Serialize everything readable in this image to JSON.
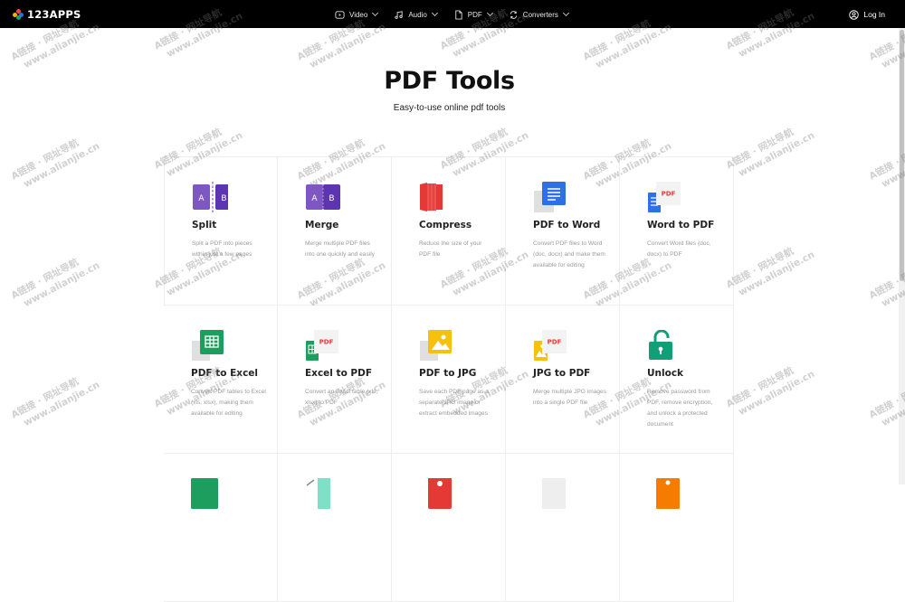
{
  "app": {
    "logo_text": "123APPS",
    "logo_colors": [
      "#f8b000",
      "#e84a3c",
      "#2d6ee8",
      "#19a463"
    ]
  },
  "nav": {
    "items": [
      {
        "label": "Video",
        "icon": "video-icon"
      },
      {
        "label": "Audio",
        "icon": "audio-icon"
      },
      {
        "label": "PDF",
        "icon": "pdf-doc-icon"
      },
      {
        "label": "Converters",
        "icon": "converters-icon"
      }
    ],
    "login_label": "Log In"
  },
  "page": {
    "title": "PDF Tools",
    "subtitle": "Easy-to-use online pdf tools"
  },
  "tools": [
    {
      "name": "Split",
      "desc": "Split a PDF into pieces within just a few pages",
      "icon": "split-icon"
    },
    {
      "name": "Merge",
      "desc": "Merge multiple PDF files into one quickly and easily",
      "icon": "merge-icon"
    },
    {
      "name": "Compress",
      "desc": "Reduce the size of your PDF file",
      "icon": "compress-icon"
    },
    {
      "name": "PDF to Word",
      "desc": "Convert PDF files to Word (doc, docx) and make them available for editing",
      "icon": "pdf-to-word-icon"
    },
    {
      "name": "Word to PDF",
      "desc": "Convert Word files (doc, docx) to PDF",
      "icon": "word-to-pdf-icon"
    },
    {
      "name": "PDF to Excel",
      "desc": "Convert PDF tables to Excel (xls, xlsx), making them available for editing",
      "icon": "pdf-to-excel-icon"
    },
    {
      "name": "Excel to PDF",
      "desc": "Convert an Excel table (xls, xlsx) to PDF",
      "icon": "excel-to-pdf-icon"
    },
    {
      "name": "PDF to JPG",
      "desc": "Save each PDF page as a separate JPG image or extract embedded images",
      "icon": "pdf-to-jpg-icon"
    },
    {
      "name": "JPG to PDF",
      "desc": "Merge multiple JPG images into a single PDF file",
      "icon": "jpg-to-pdf-icon"
    },
    {
      "name": "Unlock",
      "desc": "Remove password from PDF, remove encryption, and unlock a protected document",
      "icon": "unlock-icon"
    }
  ],
  "icon_labels": {
    "split_a": "A",
    "split_b": "B",
    "merge_a": "A",
    "merge_b": "B",
    "pdf_badge": "PDF"
  },
  "colors": {
    "purple": "#7e57c2",
    "red": "#e53935",
    "blue": "#2f6fe8",
    "green": "#1e9e5e",
    "yellow": "#f4c20d",
    "teal": "#139e7a"
  },
  "watermark": {
    "line1": "A链接 · 网址导航",
    "line2": "www.alianjie.cn"
  }
}
